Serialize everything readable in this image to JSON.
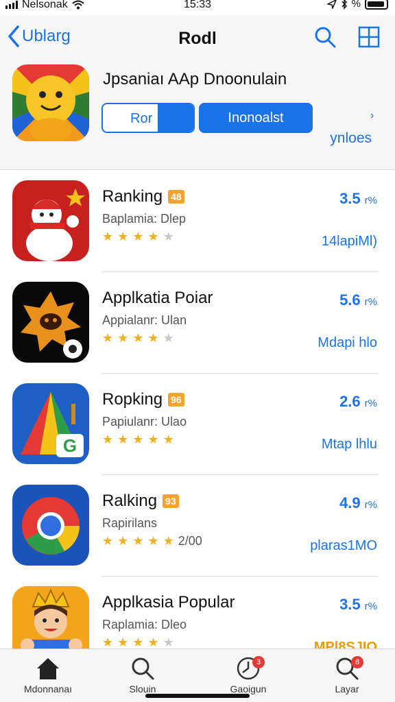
{
  "status_bar": {
    "carrier": "Nelsonak",
    "time": "15:33",
    "right_text": "%"
  },
  "nav": {
    "back_label": "Ublarg",
    "title": "Rodl",
    "search_icon": "search-icon",
    "grid_icon": "grid-icon"
  },
  "featured": {
    "title": "Jpsaniaı AAp Dnoonulain",
    "button_outline_label": "Ror",
    "button_solid_label": "Inonoalst",
    "link_label": "ynloes",
    "chevron": "›"
  },
  "apps": [
    {
      "name": "Ranking",
      "badge": "48",
      "subtitle": "Baplamia: Dlep",
      "stars": 4,
      "rating_count": "",
      "rating": "3.5",
      "rating_unit": "r%",
      "size": "14lapiMl)",
      "size_style": "blue",
      "icon": "snowman-icon"
    },
    {
      "name": "Applkatia Poiar",
      "badge": "",
      "subtitle": "Appialanr: Ulan",
      "stars": 4,
      "rating_count": "",
      "rating": "5.6",
      "rating_unit": "r%",
      "size": "Mdapi hlo",
      "size_style": "blue",
      "icon": "star-monster-icon"
    },
    {
      "name": "Ropking",
      "badge": "96",
      "subtitle": "Papiulanr: Ulao",
      "stars": 5,
      "rating_count": "",
      "rating": "2.6",
      "rating_unit": "r%",
      "size": "Mtap lhlu",
      "size_style": "blue",
      "icon": "triangle-g-icon"
    },
    {
      "name": "Ralking",
      "badge": "93",
      "subtitle": "Rapirilans",
      "stars": 5,
      "rating_count": "2/00",
      "rating": "4.9",
      "rating_unit": "r%",
      "size": "plaras1MO",
      "size_style": "blue",
      "icon": "chrome-icon"
    },
    {
      "name": "Applkasia Popular",
      "badge": "",
      "subtitle": "Raplamia: Dleo",
      "stars": 4,
      "rating_count": "",
      "rating": "3.5",
      "rating_unit": "r%",
      "size": "MPl8SJIO",
      "size_style": "orange",
      "icon": "king-character-icon"
    }
  ],
  "tabs": [
    {
      "label": "Mdonnanaı",
      "icon": "home-icon",
      "notif": ""
    },
    {
      "label": "Slouin",
      "icon": "search-icon",
      "notif": ""
    },
    {
      "label": "Gaoigun",
      "icon": "clock-icon",
      "notif": "3"
    },
    {
      "label": "Layar",
      "icon": "search-icon",
      "notif": "8"
    }
  ],
  "colors": {
    "accent": "#1a73e8",
    "star": "#f2b01e",
    "badge": "#f3a332",
    "notif": "#e53935"
  }
}
